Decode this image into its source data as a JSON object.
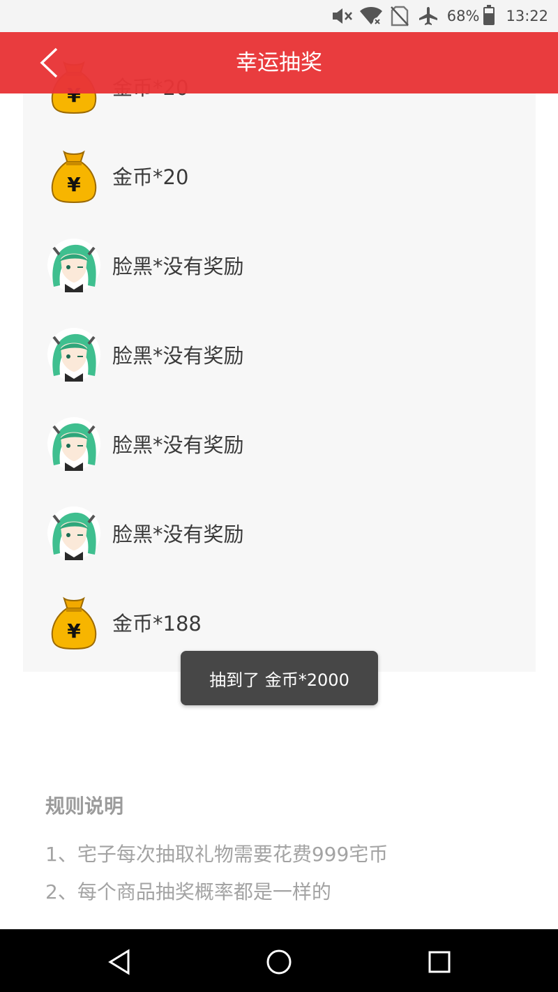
{
  "status_bar": {
    "battery_percent": "68%",
    "battery_level": 0.68,
    "time": "13:22",
    "icons": [
      "mute-icon",
      "wifi-off-icon",
      "no-sim-icon",
      "airplane-icon",
      "battery-icon"
    ]
  },
  "app_bar": {
    "title": "幸运抽奖",
    "color": "#e83436"
  },
  "list": {
    "items": [
      {
        "label": "金币*20",
        "icon": "money-bag-icon"
      },
      {
        "label": "金币*20",
        "icon": "money-bag-icon"
      },
      {
        "label": "脸黑*没有奖励",
        "icon": "anime-avatar-icon"
      },
      {
        "label": "脸黑*没有奖励",
        "icon": "anime-avatar-icon"
      },
      {
        "label": "脸黑*没有奖励",
        "icon": "anime-avatar-icon"
      },
      {
        "label": "脸黑*没有奖励",
        "icon": "anime-avatar-icon"
      },
      {
        "label": "金币*188",
        "icon": "money-bag-icon"
      }
    ]
  },
  "toast": {
    "text": "抽到了 金币*2000"
  },
  "rules": {
    "title": "规则说明",
    "lines": [
      "1、宅子每次抽取礼物需要花费999宅币",
      "2、每个商品抽奖概率都是一样的"
    ]
  },
  "nav_bar": {
    "buttons": [
      "back-nav-icon",
      "home-nav-icon",
      "recents-nav-icon"
    ]
  }
}
